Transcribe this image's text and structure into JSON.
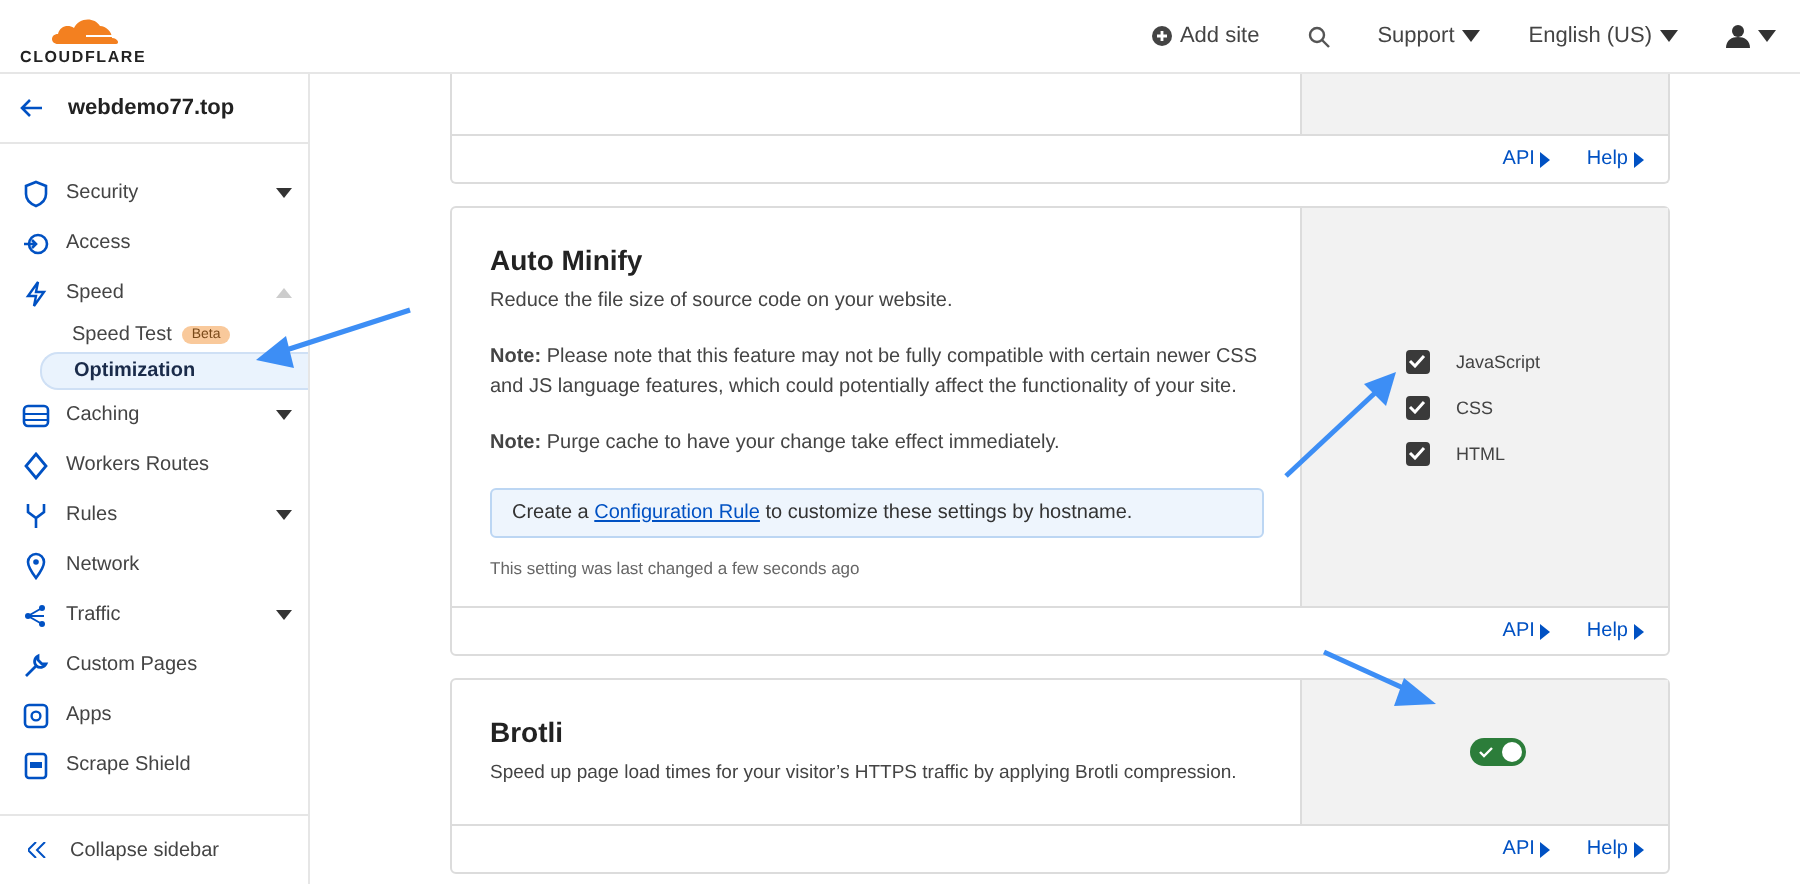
{
  "header": {
    "logo_text": "CLOUDFLARE",
    "add_site": "Add site",
    "support": "Support",
    "language": "English (US)"
  },
  "sidebar": {
    "site": "webdemo77.top",
    "items": [
      {
        "kind": "group",
        "label": "Security",
        "selected": false,
        "expanded": false
      },
      {
        "kind": "link",
        "label": "Access",
        "selected": false
      },
      {
        "kind": "group",
        "label": "Speed",
        "selected": false,
        "expanded": true,
        "children": [
          {
            "label": "Speed Test",
            "badge": "Beta",
            "selected": false
          },
          {
            "label": "Optimization",
            "selected": true
          }
        ]
      },
      {
        "kind": "group",
        "label": "Caching",
        "selected": false,
        "expanded": false
      },
      {
        "kind": "link",
        "label": "Workers Routes",
        "selected": false
      },
      {
        "kind": "group",
        "label": "Rules",
        "selected": false,
        "expanded": false
      },
      {
        "kind": "link",
        "label": "Network",
        "selected": false
      },
      {
        "kind": "group",
        "label": "Traffic",
        "selected": false,
        "expanded": false
      },
      {
        "kind": "link",
        "label": "Custom Pages",
        "selected": false
      },
      {
        "kind": "link",
        "label": "Apps",
        "selected": false
      },
      {
        "kind": "link",
        "label": "Scrape Shield",
        "selected": false
      }
    ],
    "collapse": "Collapse sidebar"
  },
  "cards": [
    {
      "kind": "stub",
      "links": [
        "API",
        "Help"
      ]
    },
    {
      "kind": "checkboxes",
      "title": "Auto Minify",
      "description": "Reduce the file size of source code on your website.",
      "notes": [
        "**Note:** Please note that this feature may not be fully compatible with certain newer CSS and JS language features, which could potentially affect the functionality of your site.",
        "**Note:** Purge cache to have your change take effect immediately."
      ],
      "callout": {
        "before": "Create a",
        "link": "Configuration Rule",
        "after": "to customize these settings by hostname."
      },
      "last_changed": "This setting was last changed a few seconds ago",
      "options": [
        {
          "label": "JavaScript",
          "checked": true
        },
        {
          "label": "CSS",
          "checked": true
        },
        {
          "label": "HTML",
          "checked": true
        }
      ],
      "links": [
        "API",
        "Help"
      ]
    },
    {
      "kind": "toggle",
      "title": "Brotli",
      "description": "Speed up page load times for your visitor’s HTTPS traffic by applying Brotli compression.",
      "on": true,
      "links": [
        "API",
        "Help"
      ]
    }
  ]
}
